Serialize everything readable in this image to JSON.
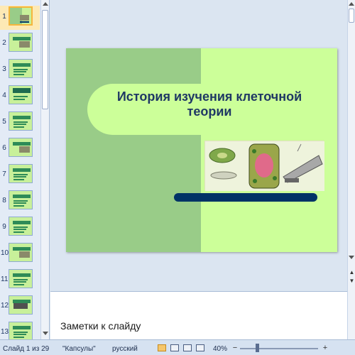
{
  "thumbnails": [
    {
      "number": "1",
      "selected": true,
      "style": "title"
    },
    {
      "number": "2",
      "selected": false,
      "style": "pic"
    },
    {
      "number": "3",
      "selected": false,
      "style": "text"
    },
    {
      "number": "4",
      "selected": false,
      "style": "band"
    },
    {
      "number": "5",
      "selected": false,
      "style": "text"
    },
    {
      "number": "6",
      "selected": false,
      "style": "pic"
    },
    {
      "number": "7",
      "selected": false,
      "style": "text"
    },
    {
      "number": "8",
      "selected": false,
      "style": "text"
    },
    {
      "number": "9",
      "selected": false,
      "style": "text"
    },
    {
      "number": "10",
      "selected": false,
      "style": "pic"
    },
    {
      "number": "11",
      "selected": false,
      "style": "text"
    },
    {
      "number": "12",
      "selected": false,
      "style": "dark"
    },
    {
      "number": "13",
      "selected": false,
      "style": "text"
    }
  ],
  "slide": {
    "title": "История изучения клеточной теории"
  },
  "notes": {
    "placeholder": "Заметки к слайду"
  },
  "status": {
    "slide_counter": "Слайд 1 из 29",
    "theme": "\"Капсулы\"",
    "language": "русский",
    "zoom": "40%"
  },
  "colors": {
    "slide_background": "#ccff99",
    "slide_left_panel": "#99cc88",
    "title_text": "#1f3864",
    "accent_bar": "#003366",
    "selected_thumbnail_border": "#f5b63c"
  }
}
